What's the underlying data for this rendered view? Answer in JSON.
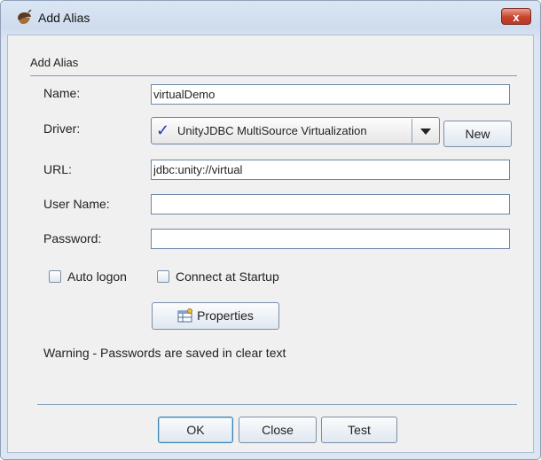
{
  "window": {
    "title": "Add Alias",
    "close_glyph": "x",
    "icon": "acorn-icon"
  },
  "group": {
    "title": "Add Alias"
  },
  "form": {
    "name_label": "Name:",
    "name_value": "virtualDemo",
    "driver_label": "Driver:",
    "driver_value": "UnityJDBC MultiSource Virtualization",
    "driver_check": "✓",
    "new_button": "New",
    "url_label": "URL:",
    "url_value": "jdbc:unity://virtual",
    "user_label": "User Name:",
    "user_value": "",
    "password_label": "Password:",
    "password_value": ""
  },
  "options": {
    "auto_logon": {
      "label": "Auto logon",
      "checked": false
    },
    "connect_startup": {
      "label": "Connect at Startup",
      "checked": false
    }
  },
  "properties_button": "Properties",
  "warning": "Warning - Passwords are saved in clear text",
  "footer": {
    "ok": "OK",
    "close": "Close",
    "test": "Test"
  },
  "colors": {
    "title_gradient_top": "#dbe6f4",
    "content_bg": "#f0f0f0",
    "close_red": "#c7442d",
    "separator_blue": "#7f9db9",
    "check_blue": "#1b3fc0"
  }
}
